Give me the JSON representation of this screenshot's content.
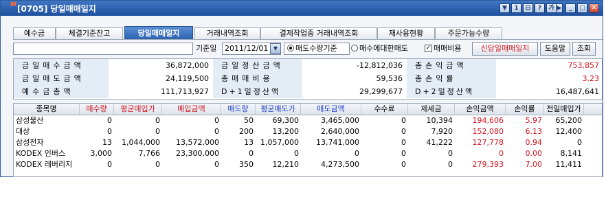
{
  "window": {
    "title": "[0705] 당일매매일지",
    "logo": "M",
    "logo_mark": "+",
    "title_buttons": [
      "▼",
      "1",
      "⊟",
      "?",
      "가",
      "▶",
      "_",
      "□",
      "✕"
    ]
  },
  "tabs": [
    {
      "label": "예수금",
      "active": false
    },
    {
      "label": "체결기준잔고",
      "active": false
    },
    {
      "label": "당일매매일지",
      "active": true
    },
    {
      "label": "거래내역조회",
      "active": false
    },
    {
      "label": "결제작업중 거래내역조회",
      "active": false
    },
    {
      "label": "재사용현황",
      "active": false
    },
    {
      "label": "주문가능수량",
      "active": false
    }
  ],
  "toolbar": {
    "account_value": "",
    "date_label": "기준일",
    "date_value": "2011/12/01",
    "radio_sell_qty": "매도수량기준",
    "radio_buy_sell": "매수에대한매도",
    "checkbox_fee": "매매비용",
    "checkbox_checked_mark": "✓",
    "btn_print": "신당일매매일지",
    "btn_help": "도움말",
    "btn_query": "조회"
  },
  "summary": {
    "rows": [
      {
        "l1": "금일매수금액",
        "v1": "36,872,000",
        "l2": "금일정산금액",
        "v2": "-12,812,036",
        "l3": "총손익금액",
        "v3": "753,857"
      },
      {
        "l1": "금일매도금액",
        "v1": "24,119,500",
        "l2": "총매매비용",
        "v2": "59,536",
        "l3": "총손익률",
        "v3": "3.23"
      },
      {
        "l1": "예수금총액",
        "v1": "111,713,927",
        "l2": "D+1일정산액",
        "v2": "29,299,677",
        "l3": "D+2일정산액",
        "v3": "16,487,641"
      }
    ]
  },
  "grid": {
    "columns": [
      {
        "label": "종목명",
        "color": "black"
      },
      {
        "label": "매수량",
        "color": "red"
      },
      {
        "label": "평균매입가",
        "color": "red"
      },
      {
        "label": "매입금액",
        "color": "red"
      },
      {
        "label": "매도량",
        "color": "blue"
      },
      {
        "label": "평균매도가",
        "color": "blue"
      },
      {
        "label": "매도금액",
        "color": "blue"
      },
      {
        "label": "수수료",
        "color": "black"
      },
      {
        "label": "제세금",
        "color": "black"
      },
      {
        "label": "손익금액",
        "color": "black"
      },
      {
        "label": "손익률",
        "color": "black"
      },
      {
        "label": "전일매입가",
        "color": "black"
      }
    ],
    "rows": [
      [
        "삼성물산",
        "0",
        "0",
        "0",
        "50",
        "69,300",
        "3,465,000",
        "0",
        "10,394",
        "194,606",
        "5.97",
        "65,200"
      ],
      [
        "대상",
        "0",
        "0",
        "0",
        "200",
        "13,200",
        "2,640,000",
        "0",
        "7,920",
        "152,080",
        "6.13",
        "12,400"
      ],
      [
        "삼성전자",
        "13",
        "1,044,000",
        "13,572,000",
        "13",
        "1,057,000",
        "13,741,000",
        "0",
        "41,222",
        "127,778",
        "0.94",
        "0"
      ],
      [
        "KODEX 인버스",
        "3,000",
        "7,766",
        "23,300,000",
        "0",
        "0",
        "0",
        "0",
        "0",
        "0",
        "0.00",
        "8,141"
      ],
      [
        "KODEX 레버리지",
        "0",
        "0",
        "0",
        "350",
        "12,210",
        "4,273,500",
        "0",
        "0",
        "279,393",
        "7.00",
        "11,411"
      ]
    ]
  },
  "colors": {
    "title_bar": "#1d4f9c",
    "active_tab": "#2a5fae",
    "profit_red": "#d0141c",
    "sell_blue": "#1a3fc8",
    "label_bg": "#e4ecf6"
  }
}
